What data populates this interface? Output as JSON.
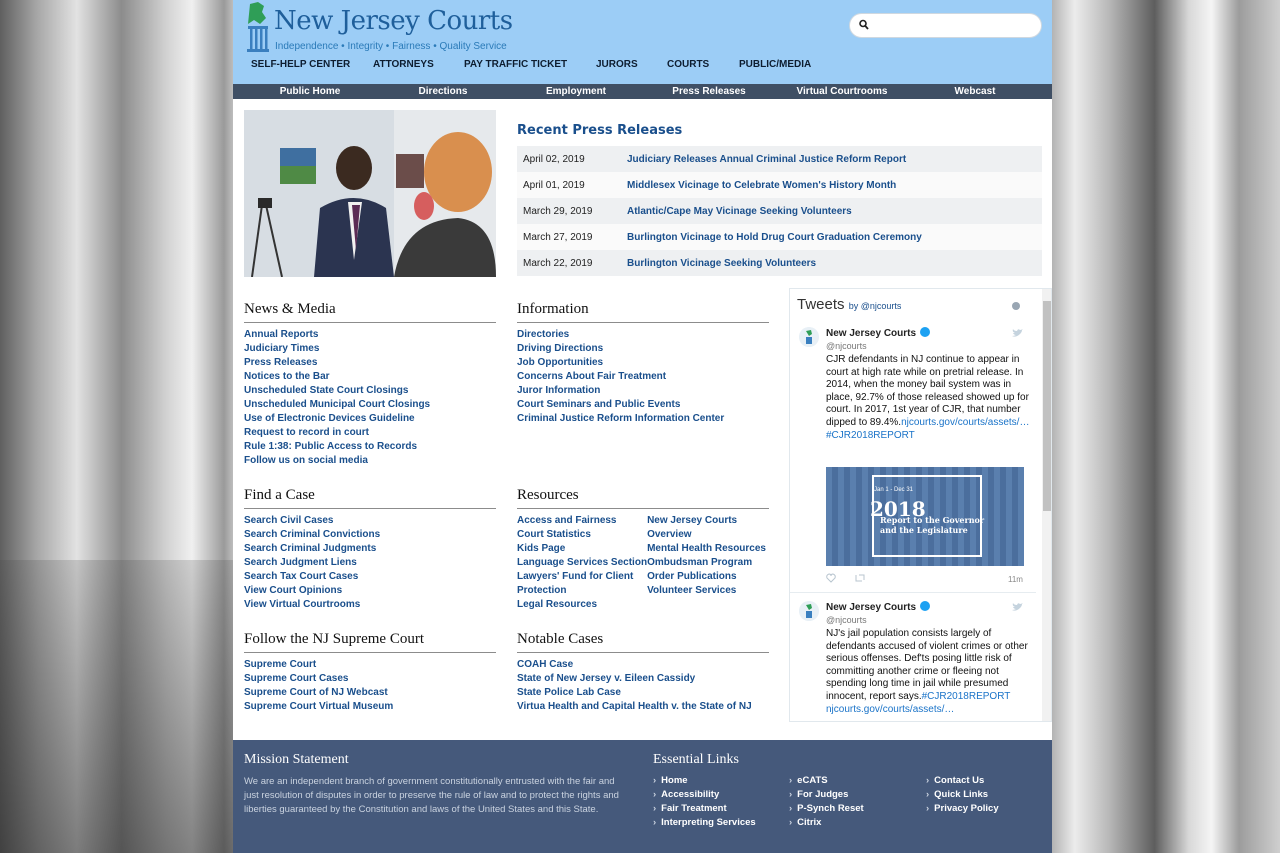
{
  "header": {
    "logo_title": "New Jersey Courts",
    "logo_tagline": "Independence • Integrity • Fairness • Quality Service",
    "search_placeholder": ""
  },
  "main_nav": [
    "SELF-HELP CENTER",
    "ATTORNEYS",
    "PAY TRAFFIC TICKET",
    "JURORS",
    "COURTS",
    "PUBLIC/MEDIA"
  ],
  "sub_nav": [
    "Public Home",
    "Directions",
    "Employment",
    "Press Releases",
    "Virtual Courtrooms",
    "Webcast"
  ],
  "press": {
    "title": "Recent Press Releases",
    "items": [
      {
        "date": "April 02, 2019",
        "title": "Judiciary Releases Annual Criminal Justice Reform Report"
      },
      {
        "date": "April 01, 2019",
        "title": "Middlesex Vicinage to Celebrate Women's History Month"
      },
      {
        "date": "March 29, 2019",
        "title": "Atlantic/Cape May Vicinage Seeking Volunteers"
      },
      {
        "date": "March 27, 2019",
        "title": "Burlington Vicinage to Hold Drug Court Graduation Ceremony"
      },
      {
        "date": "March 22, 2019",
        "title": "Burlington Vicinage Seeking Volunteers"
      }
    ]
  },
  "news_media": {
    "title": "News & Media",
    "links": [
      "Annual Reports",
      "Judiciary Times",
      "Press Releases",
      "Notices to the Bar",
      "Unscheduled State Court Closings",
      "Unscheduled Municipal Court Closings",
      "Use of Electronic Devices Guideline",
      "Request to record in court",
      "Rule 1:38: Public Access to Records",
      "Follow us on social media"
    ]
  },
  "information": {
    "title": "Information",
    "links": [
      "Directories",
      "Driving Directions",
      "Job Opportunities",
      "Concerns About Fair Treatment",
      "Juror Information",
      "Court Seminars and Public Events",
      "Criminal Justice Reform Information Center"
    ]
  },
  "find_case": {
    "title": "Find a Case",
    "links": [
      "Search Civil Cases",
      "Search Criminal Convictions",
      "Search Criminal Judgments",
      "Search Judgment Liens",
      "Search Tax Court Cases",
      "View Court Opinions",
      "View Virtual Courtrooms"
    ]
  },
  "resources": {
    "title": "Resources",
    "col1": [
      "Access and Fairness",
      "Court Statistics",
      "Kids Page",
      "Language Services Section",
      "Lawyers' Fund for Client",
      "Protection",
      "Legal Resources"
    ],
    "col2": [
      "New Jersey Courts",
      "Overview",
      "Mental Health Resources",
      "Ombudsman Program",
      "Order Publications",
      "Volunteer Services"
    ]
  },
  "supreme": {
    "title": "Follow the NJ Supreme Court",
    "links": [
      "Supreme Court",
      "Supreme Court Cases",
      "Supreme Court of NJ Webcast",
      "Supreme Court Virtual Museum"
    ]
  },
  "notable": {
    "title": "Notable Cases",
    "links": [
      "COAH Case",
      "State of New Jersey v. Eileen Cassidy",
      "State Police Lab Case",
      "Virtua Health and Capital Health v. the State of NJ"
    ]
  },
  "tweets": {
    "title": "Tweets",
    "by": "by @njcourts",
    "items": [
      {
        "name": "New Jersey Courts",
        "handle": "@njcourts",
        "text": "CJR defendants in NJ continue to appear in court at high rate while on pretrial release. In 2014, when the money bail system was in place, 92.7% of those released showed up for court. In 2017, 1st year of CJR, that number dipped to 89.4%.",
        "link": "njcourts.gov/courts/assets/…",
        "hashtag": "#CJR2018REPORT",
        "time": "11m",
        "image_year": "2018",
        "image_range": "Jan 1 - Dec 31",
        "image_sub1": "Report to the Governor",
        "image_sub2": "and the Legislature"
      },
      {
        "name": "New Jersey Courts",
        "handle": "@njcourts",
        "text": "NJ's jail population consists largely of defendants accused of violent crimes or other serious offenses. Def'ts posing little risk of committing another crime or fleeing not spending long time in jail while presumed innocent, report says.",
        "hashtag": "#CJR2018REPORT",
        "link": "njcourts.gov/courts/assets/…"
      }
    ]
  },
  "footer": {
    "mission_title": "Mission Statement",
    "mission_text": "We are an independent branch of government constitutionally entrusted with the fair and just resolution of disputes in order to preserve the rule of law and to protect the rights and liberties guaranteed by the Constitution and laws of the United States and this State.",
    "links_title": "Essential Links",
    "col1": [
      "Home",
      "Accessibility",
      "Fair Treatment",
      "Interpreting Services"
    ],
    "col2": [
      "eCATS",
      "For Judges",
      "P-Synch Reset",
      "Citrix"
    ],
    "col3": [
      "Contact Us",
      "Quick Links",
      "Privacy Policy"
    ]
  },
  "colors": {
    "header_bg": "#9ccdf6",
    "subnav_bg": "#3f4f64",
    "link": "#1a4f8c",
    "footer_bg": "#45597b"
  }
}
